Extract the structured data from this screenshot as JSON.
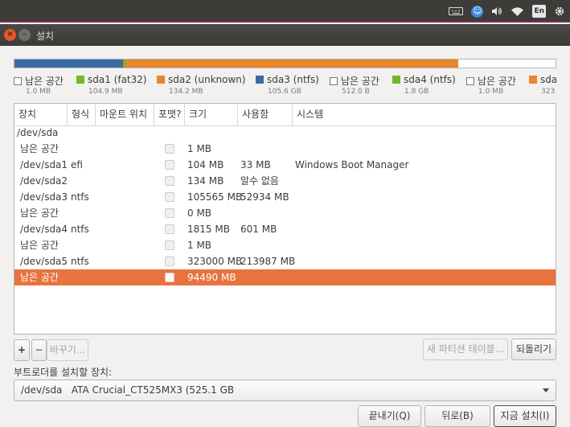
{
  "top_panel": {
    "lang": "En",
    "icons": [
      "keyboard-icon",
      "accessibility-icon",
      "volume-icon",
      "wifi-icon",
      "language-indicator",
      "gear-icon"
    ]
  },
  "window": {
    "title": "설치"
  },
  "partition_bar": [
    {
      "color": "#3b6aa3",
      "size_mb": 105565
    },
    {
      "color": "#76b52a",
      "size_mb": 1815
    },
    {
      "color": "#e9852b",
      "size_mb": 323000
    },
    {
      "color": "#ffffff",
      "size_mb": 94490
    }
  ],
  "legend": [
    {
      "name": "남은 공간",
      "size": "1.0 MB",
      "color": ""
    },
    {
      "name": "sda1 (fat32)",
      "size": "104.9 MB",
      "color": "#76b52a"
    },
    {
      "name": "sda2 (unknown)",
      "size": "134.2 MB",
      "color": "#e9852b"
    },
    {
      "name": "sda3 (ntfs)",
      "size": "105.6 GB",
      "color": "#3b6aa3"
    },
    {
      "name": "남은 공간",
      "size": "512.0 B",
      "color": ""
    },
    {
      "name": "sda4 (ntfs)",
      "size": "1.8 GB",
      "color": "#76b52a"
    },
    {
      "name": "남은 공간",
      "size": "1.0 MB",
      "color": ""
    },
    {
      "name": "sda",
      "size": "323",
      "color": "#e9852b"
    }
  ],
  "table": {
    "headers": [
      "장치",
      "형식",
      "마운트 위치",
      "포맷?",
      "크기",
      "사용함",
      "시스템"
    ],
    "group": "/dev/sda",
    "rows": [
      {
        "device": "남은 공간",
        "type": "",
        "mount": "",
        "size": "1 MB",
        "used": "",
        "system": ""
      },
      {
        "device": "/dev/sda1",
        "type": "efi",
        "mount": "",
        "size": "104 MB",
        "used": "33 MB",
        "system": "Windows Boot Manager"
      },
      {
        "device": "/dev/sda2",
        "type": "",
        "mount": "",
        "size": "134 MB",
        "used": "알수 없음",
        "system": ""
      },
      {
        "device": "/dev/sda3",
        "type": "ntfs",
        "mount": "",
        "size": "105565 MB",
        "used": "52934 MB",
        "system": ""
      },
      {
        "device": "남은 공간",
        "type": "",
        "mount": "",
        "size": "0 MB",
        "used": "",
        "system": ""
      },
      {
        "device": "/dev/sda4",
        "type": "ntfs",
        "mount": "",
        "size": "1815 MB",
        "used": "601 MB",
        "system": ""
      },
      {
        "device": "남은 공간",
        "type": "",
        "mount": "",
        "size": "1 MB",
        "used": "",
        "system": ""
      },
      {
        "device": "/dev/sda5",
        "type": "ntfs",
        "mount": "",
        "size": "323000 MB",
        "used": "213987 MB",
        "system": ""
      },
      {
        "device": "남은 공간",
        "type": "",
        "mount": "",
        "size": "94490 MB",
        "used": "",
        "system": "",
        "selected": true
      }
    ]
  },
  "buttons": {
    "add": "+",
    "remove": "−",
    "change": "바꾸기...",
    "new_table": "새 파티션 테이블...",
    "revert": "되돌리기",
    "quit": "끝내기(Q)",
    "back": "뒤로(B)",
    "install": "지금 설치(I)"
  },
  "bootloader": {
    "label": "부트로더를 설치할 장치:",
    "device": "/dev/sda",
    "description": "ATA Crucial_CT525MX3 (525.1 GB"
  },
  "colors": {
    "selection": "#e9733f",
    "accent_close": "#e8572a",
    "panel": "#3d3c38"
  }
}
